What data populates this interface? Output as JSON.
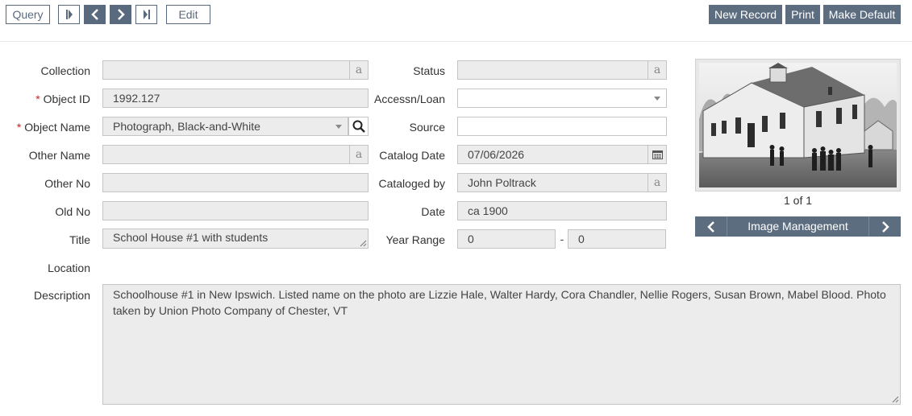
{
  "toolbar": {
    "query_label": "Query",
    "edit_label": "Edit",
    "new_record_label": "New Record",
    "print_label": "Print",
    "make_default_label": "Make Default"
  },
  "labels": {
    "collection": "Collection",
    "object_id": "Object ID",
    "object_name": "Object Name",
    "other_name": "Other Name",
    "other_no": "Other No",
    "old_no": "Old No",
    "title": "Title",
    "location": "Location",
    "description": "Description",
    "status": "Status",
    "accessn_loan": "Accessn/Loan",
    "source": "Source",
    "catalog_date": "Catalog Date",
    "cataloged_by": "Cataloged by",
    "date": "Date",
    "year_range": "Year Range",
    "required_mark": "*",
    "lookup_glyph": "a",
    "range_separator": "-"
  },
  "fields": {
    "collection": "",
    "object_id": "1992.127",
    "object_name": "Photograph, Black-and-White",
    "other_name": "",
    "other_no": "",
    "old_no": "",
    "title": "School House #1 with students",
    "description": "Schoolhouse #1 in New Ipswich. Listed name on the photo are Lizzie Hale, Walter Hardy, Cora Chandler, Nellie Rogers, Susan Brown, Mabel Blood. Photo taken by Union Photo Company of Chester, VT",
    "status": "",
    "accessn_loan": "",
    "source": "",
    "catalog_date": "07/06/2026",
    "cataloged_by": "John Poltrack",
    "date": "ca 1900",
    "year_range_from": "0",
    "year_range_to": "0"
  },
  "image": {
    "counter": "1 of 1",
    "management_label": "Image Management"
  },
  "icons": {
    "first": "first-record-icon",
    "prev": "previous-record-icon",
    "next": "next-record-icon",
    "last": "last-record-icon",
    "search": "search-icon",
    "calendar": "calendar-icon"
  },
  "colors": {
    "accent": "#5d6d80",
    "required": "#cc2222",
    "field_bg": "#ececec"
  }
}
